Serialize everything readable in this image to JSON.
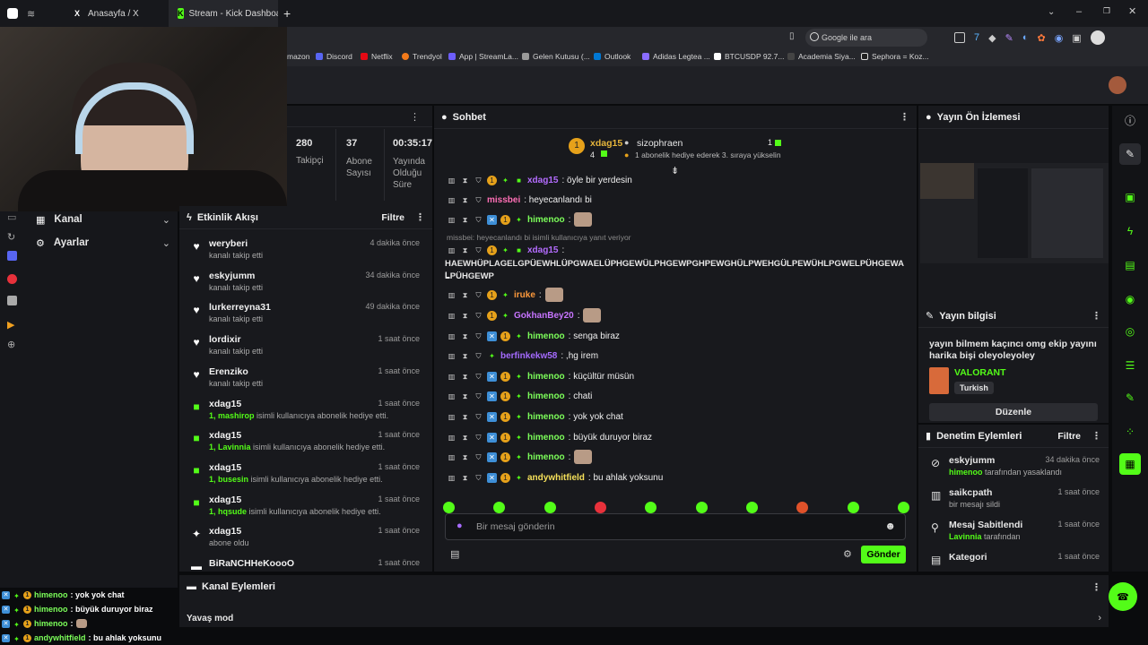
{
  "browser": {
    "tabs": [
      {
        "icon": "x-icon",
        "title": "Anasayfa / X"
      },
      {
        "icon": "kick-icon",
        "title": "Stream - Kick Dashboard"
      }
    ],
    "new_tab": "+",
    "search_placeholder": "Google ile ara",
    "bookmarks": [
      "mazon",
      "Discord",
      "Netflix",
      "Trendyol",
      "App | StreamLa...",
      "Gelen Kutusu (...",
      "Outlook",
      "Adidas Legtea ...",
      "BTCUSDP 92.7...",
      "Academia Siya...",
      "Sephora = Koz..."
    ]
  },
  "stats": [
    {
      "value": "280",
      "label": "Takipçi"
    },
    {
      "value": "37",
      "label": "Abone Sayısı"
    },
    {
      "value": "00:35:17",
      "label": "Yayında Olduğu Süre"
    }
  ],
  "sidebar": {
    "items": [
      {
        "label": "Kanal"
      },
      {
        "label": "Ayarlar"
      }
    ]
  },
  "activity": {
    "title": "Etkinlik Akışı",
    "filter": "Filtre",
    "events": [
      {
        "icon": "heart",
        "name": "weryberi",
        "sub": "kanalı takip etti",
        "time": "4 dakika önce"
      },
      {
        "icon": "heart",
        "name": "eskyjumm",
        "sub": "kanalı takip etti",
        "time": "34 dakika önce"
      },
      {
        "icon": "heart",
        "name": "lurkerreyna31",
        "sub": "kanalı takip etti",
        "time": "49 dakika önce"
      },
      {
        "icon": "heart",
        "name": "lordixir",
        "sub": "kanalı takip etti",
        "time": "1 saat önce"
      },
      {
        "icon": "heart",
        "name": "Erenziko",
        "sub": "kanalı takip etti",
        "time": "1 saat önce"
      },
      {
        "icon": "gift",
        "name": "xdag15",
        "sub_b": "1, mashirop",
        "sub": " isimli kullanıcıya abonelik hediye etti.",
        "time": "1 saat önce"
      },
      {
        "icon": "gift",
        "name": "xdag15",
        "sub_b": "1, Lavinnia",
        "sub": " isimli kullanıcıya abonelik hediye etti.",
        "time": "1 saat önce"
      },
      {
        "icon": "gift",
        "name": "xdag15",
        "sub_b": "1, busesin",
        "sub": " isimli kullanıcıya abonelik hediye etti.",
        "time": "1 saat önce"
      },
      {
        "icon": "gift",
        "name": "xdag15",
        "sub_b": "1, hqsude",
        "sub": " isimli kullanıcıya abonelik hediye etti.",
        "time": "1 saat önce"
      },
      {
        "icon": "star",
        "name": "xdag15",
        "sub": "abone oldu",
        "time": "1 saat önce"
      },
      {
        "icon": "host",
        "name": "BiRaNCHHeKoooO",
        "sub": "",
        "time": "1 saat önce"
      }
    ]
  },
  "chat": {
    "title": "Sohbet",
    "leader": {
      "name": "xdag15",
      "count": "4",
      "second": "sizophraen",
      "second_count": "1",
      "note": "1 abonelik hediye ederek 3. sıraya yükselin"
    },
    "reply_note": "missbei: heyecanlandı bi isimli kullanıcıya yanıt veriyor",
    "messages": [
      {
        "user": "xdag15",
        "color": "#b46cff",
        "text": ": öyle bir yerdesin"
      },
      {
        "user": "missbei",
        "color": "#ff6fb5",
        "text": ": heyecanlandı bi"
      },
      {
        "user": "himenoo",
        "color": "#7cff5a",
        "text": ":",
        "emote": true
      },
      {
        "user": "xdag15",
        "color": "#b46cff",
        "text": ":"
      },
      {
        "user": "iruke",
        "color": "#ff9a3c",
        "text": ":",
        "emote": true
      },
      {
        "user": "GokhanBey20",
        "color": "#c774ff",
        "text": ":",
        "emote": true
      },
      {
        "user": "himenoo",
        "color": "#7cff5a",
        "text": ": senga biraz"
      },
      {
        "user": "berfinkekw58",
        "color": "#a56bff",
        "text": ": ,hg irem"
      },
      {
        "user": "himenoo",
        "color": "#7cff5a",
        "text": ": küçültür müsün"
      },
      {
        "user": "himenoo",
        "color": "#7cff5a",
        "text": ": chati"
      },
      {
        "user": "himenoo",
        "color": "#7cff5a",
        "text": ": yok yok chat"
      },
      {
        "user": "himenoo",
        "color": "#7cff5a",
        "text": ": büyük duruyor biraz"
      },
      {
        "user": "himenoo",
        "color": "#7cff5a",
        "text": ":",
        "emote": true
      },
      {
        "user": "andywhitfield",
        "color": "#f5e05a",
        "text": ": bu ahlak yoksunu"
      }
    ],
    "long_message": "HAEWHÜPLAGELGPÜEWHLÜPGWAELÜPHGEWÜLPHGEWPGHPEWGHÜLPWEHGÜLPEWÜHLPGWELPÜHGEWALPÜHGEWP",
    "long_message_tail": "L",
    "input_placeholder": "Bir mesaj gönderin",
    "send": "Gönder"
  },
  "preview": {
    "title": "Yayın Ön İzlemesi"
  },
  "stream_info": {
    "title": "Yayın bilgisi",
    "stream_title": "yayın bilmem kaçıncı omg ekip yayını harika bişi oleyoleyoley",
    "game": "VALORANT",
    "language": "Turkish",
    "edit": "Düzenle"
  },
  "moderation": {
    "title": "Denetim Eylemleri",
    "filter": "Filtre",
    "items": [
      {
        "icon": "ban",
        "name": "eskyjumm",
        "sub_b": "himenoo",
        "sub": " tarafından yasaklandı",
        "time": "34 dakika önce"
      },
      {
        "icon": "trash",
        "name": "saikcpath",
        "sub": "bir mesajı sildi",
        "time": "1 saat önce"
      },
      {
        "icon": "pin",
        "name": "Mesaj Sabitlendi",
        "sub_b": "Lavinnia",
        "sub": " tarafından",
        "time": "1 saat önce"
      },
      {
        "icon": "category",
        "name": "Kategori",
        "sub": "",
        "time": "1 saat önce"
      }
    ]
  },
  "channel_actions": {
    "title": "Kanal Eylemleri",
    "slow_mode": "Yavaş mod"
  },
  "overlay_chat": [
    {
      "user": "himenoo",
      "text": ": yok yok chat"
    },
    {
      "user": "himenoo",
      "text": ": büyük duruyor biraz"
    },
    {
      "user": "himenoo",
      "text": ":"
    },
    {
      "user": "andywhitfield",
      "text": ": bu ahlak yoksunu"
    }
  ],
  "colors": {
    "accent": "#53fc18",
    "bg": "#0a0b0d",
    "panel": "#18191d"
  }
}
